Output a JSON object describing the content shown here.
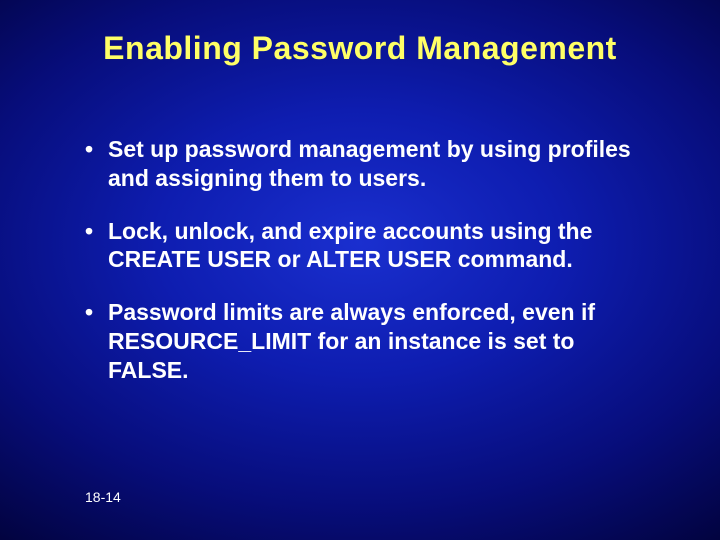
{
  "slide": {
    "title": "Enabling Password Management",
    "bullets": [
      "Set up password management by using profiles and assigning them to users.",
      "Lock, unlock, and expire accounts using the CREATE USER or ALTER USER command.",
      "Password limits are always enforced, even if RESOURCE_LIMIT for an instance is set to FALSE."
    ],
    "footer": "18-14"
  }
}
